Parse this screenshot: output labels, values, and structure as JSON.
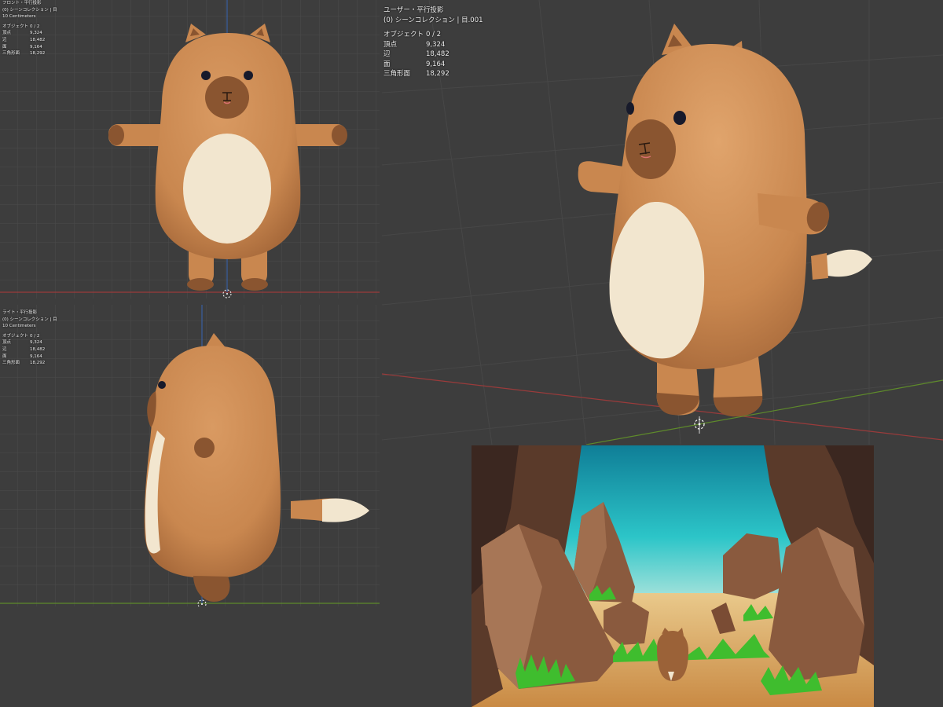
{
  "viewports": {
    "front": {
      "title": "フロント・平行投影",
      "collection": "(0) シーンコレクション | 目",
      "scale": "10 Centimeters",
      "stats": [
        {
          "label": "オブジェクト",
          "value": "0 / 2"
        },
        {
          "label": "頂点",
          "value": "9,324"
        },
        {
          "label": "辺",
          "value": "18,482"
        },
        {
          "label": "面",
          "value": "9,164"
        },
        {
          "label": "三角形面",
          "value": "18,292"
        }
      ]
    },
    "right": {
      "title": "ライト・平行投影",
      "collection": "(0) シーンコレクション | 目",
      "scale": "10 Centimeters",
      "stats": [
        {
          "label": "オブジェクト",
          "value": "0 / 2"
        },
        {
          "label": "頂点",
          "value": "9,324"
        },
        {
          "label": "辺",
          "value": "18,482"
        },
        {
          "label": "面",
          "value": "9,164"
        },
        {
          "label": "三角形面",
          "value": "18,292"
        }
      ]
    },
    "user": {
      "title": "ユーザー・平行投影",
      "collection": "(0) シーンコレクション | 目.001",
      "stats": [
        {
          "label": "オブジェクト",
          "value": "0 / 2"
        },
        {
          "label": "頂点",
          "value": "9,324"
        },
        {
          "label": "辺",
          "value": "18,482"
        },
        {
          "label": "面",
          "value": "9,164"
        },
        {
          "label": "三角形面",
          "value": "18,292"
        }
      ]
    }
  },
  "colors": {
    "viewport_bg": "#3d3d3d",
    "grid_line": "#4a4a4a",
    "axis_x": "#9a3b3b",
    "axis_y": "#5e8a2b",
    "axis_z": "#3a5fa0",
    "body": "#c9874f",
    "body_dark": "#8a5530",
    "belly": "#f2e6cf",
    "sky": "#2cc5c8",
    "rock": "#8a5a3e",
    "grass": "#3fbd2e",
    "sand": "#d8a155"
  },
  "icons": {
    "origin": "3d-cursor-icon"
  }
}
